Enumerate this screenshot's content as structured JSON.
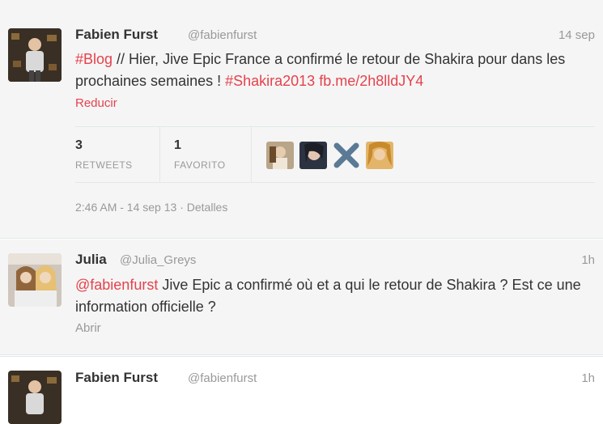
{
  "tweets": [
    {
      "name": "Fabien Furst",
      "handle": "@fabienfurst",
      "time": "14 sep",
      "text_parts": {
        "tag1": "#Blog",
        "body": " // Hier, Jive Epic France a confirmé le retour de Shakira pour dans les prochaines semaines ! ",
        "tag2": "#Shakira2013",
        "space": " ",
        "url": "fb.me/2h8lldJY4"
      },
      "expand_label": "Reducir",
      "stats": {
        "retweets_count": "3",
        "retweets_label": "RETWEETS",
        "favorites_count": "1",
        "favorites_label": "FAVORITO"
      },
      "meta": {
        "timestamp": "2:46 AM - 14 sep 13",
        "separator": " · ",
        "details": "Detalles"
      }
    },
    {
      "name": "Julia",
      "handle": "@Julia_Greys",
      "time": "1h",
      "text_parts": {
        "mention": "@fabienfurst",
        "body": " Jive Epic a  confirmé où et a qui le retour de Shakira ? Est ce une information officielle ?"
      },
      "expand_label": "Abrir"
    },
    {
      "name": "Fabien Furst",
      "handle": "@fabienfurst",
      "time": "1h"
    }
  ],
  "colors": {
    "link": "#e5424c",
    "muted": "#999999",
    "text": "#333333",
    "background": "#f5f5f5"
  },
  "icons": {
    "favoriter_icons": [
      "user-avatar",
      "user-avatar",
      "x-icon",
      "user-avatar"
    ]
  }
}
